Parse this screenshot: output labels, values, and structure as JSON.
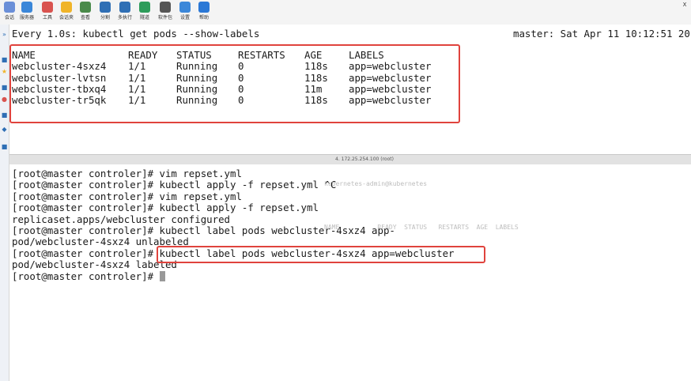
{
  "toolbar": {
    "items": [
      {
        "label": "会话",
        "color": "#6a8fd8"
      },
      {
        "label": "服务器",
        "color": "#3b87d9"
      },
      {
        "label": "工具",
        "color": "#d9534f"
      },
      {
        "label": "会话夹",
        "color": "#f0b429"
      },
      {
        "label": "查看",
        "color": "#4a8a4a"
      },
      {
        "label": "分割",
        "color": "#2f6fb5"
      },
      {
        "label": "多执行",
        "color": "#2f6fb5"
      },
      {
        "label": "隧道",
        "color": "#2d9c5a"
      },
      {
        "label": "软件包",
        "color": "#555555"
      },
      {
        "label": "设置",
        "color": "#3b87d9"
      },
      {
        "label": "帮助",
        "color": "#2b78d6"
      }
    ],
    "right_label": "X"
  },
  "top_pane": {
    "watch_cmd": "Every 1.0s: kubectl get pods --show-labels",
    "watch_host": "master: Sat Apr 11 10:12:51 20",
    "table": {
      "headers": [
        "NAME",
        "READY",
        "STATUS",
        "RESTARTS",
        "AGE",
        "LABELS"
      ],
      "rows": [
        [
          "webcluster-4sxz4",
          "1/1",
          "Running",
          "0",
          "118s",
          "app=webcluster"
        ],
        [
          "webcluster-lvtsn",
          "1/1",
          "Running",
          "0",
          "118s",
          "app=webcluster"
        ],
        [
          "webcluster-tbxq4",
          "1/1",
          "Running",
          "0",
          "11m",
          "app=webcluster"
        ],
        [
          "webcluster-tr5qk",
          "1/1",
          "Running",
          "0",
          "118s",
          "app=webcluster"
        ]
      ]
    }
  },
  "divider": {
    "label": "4. 172.25.254.100 (root)"
  },
  "bottom_pane": {
    "lines": [
      "[root@master controler]# vim repset.yml",
      "[root@master controler]# kubectl apply -f repset.yml ^C",
      "[root@master controler]# vim repset.yml",
      "[root@master controler]# kubectl apply -f repset.yml",
      "replicaset.apps/webcluster configured",
      "[root@master controler]# kubectl label pods webcluster-4sxz4 app-",
      "pod/webcluster-4sxz4 unlabeled",
      "[root@master controler]# kubectl label pods webcluster-4sxz4 app=webcluster",
      "pod/webcluster-4sxz4 labeled",
      "[root@master controler]# "
    ]
  }
}
